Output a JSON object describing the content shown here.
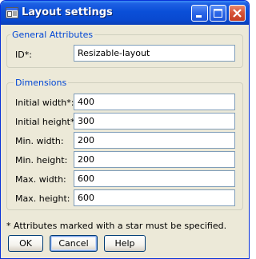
{
  "window": {
    "title": "Layout settings",
    "controls": {
      "minimize": "minimize-icon",
      "maximize": "maximize-icon",
      "close": "close-icon"
    }
  },
  "general": {
    "legend": "General Attributes",
    "id_label": "ID*:",
    "id_value": "Resizable-layout"
  },
  "dimensions": {
    "legend": "Dimensions",
    "fields": [
      {
        "label": "Initial width*:",
        "value": "400"
      },
      {
        "label": "Initial height*:",
        "value": "300"
      },
      {
        "label": "Min. width:",
        "value": "200"
      },
      {
        "label": "Min. height:",
        "value": "200"
      },
      {
        "label": "Max. width:",
        "value": "600"
      },
      {
        "label": "Max. height:",
        "value": "600"
      }
    ]
  },
  "footer": {
    "note": "* Attributes marked with a star must be specified."
  },
  "buttons": {
    "ok": "OK",
    "cancel": "Cancel",
    "help": "Help"
  },
  "colors": {
    "titlebar": "#0a4fd8",
    "legend_text": "#0046d5",
    "dialog_bg": "#ece9d8",
    "field_border": "#7f9db9"
  }
}
